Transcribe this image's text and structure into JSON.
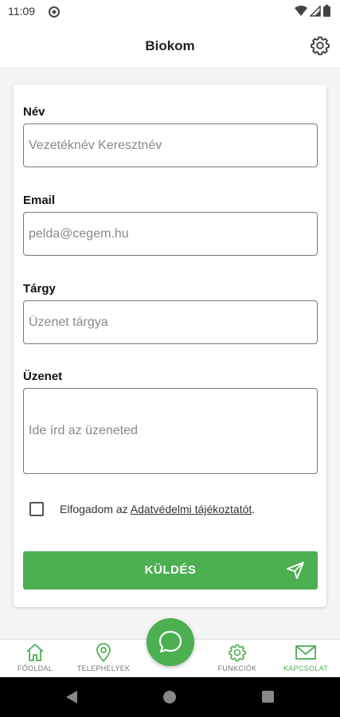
{
  "status": {
    "time": "11:09"
  },
  "header": {
    "title": "Biokom"
  },
  "form": {
    "name_label": "Név",
    "name_placeholder": "Vezetéknév Keresztnév",
    "email_label": "Email",
    "email_placeholder": "pelda@cegem.hu",
    "subject_label": "Tárgy",
    "subject_placeholder": "Üzenet tárgya",
    "message_label": "Üzenet",
    "message_placeholder": "Ide írd az üzeneted",
    "consent_prefix": "Elfogadom az ",
    "consent_link": "Adatvédelmi tájékoztatót",
    "consent_suffix": ".",
    "consent_checked": false,
    "submit_label": "KÜLDÉS"
  },
  "nav": {
    "items": [
      {
        "label": "FŐOLDAL",
        "icon": "home-icon"
      },
      {
        "label": "TELEPHELYEK",
        "icon": "location-pin-icon"
      },
      {
        "label": "FUNKCIÓK",
        "icon": "gear-icon"
      },
      {
        "label": "KAPCSOLAT",
        "icon": "mail-icon",
        "active": true
      }
    ],
    "fab_icon": "chat-bubble-icon"
  },
  "colors": {
    "accent": "#4caf50",
    "text": "#222222",
    "muted": "#777777"
  }
}
